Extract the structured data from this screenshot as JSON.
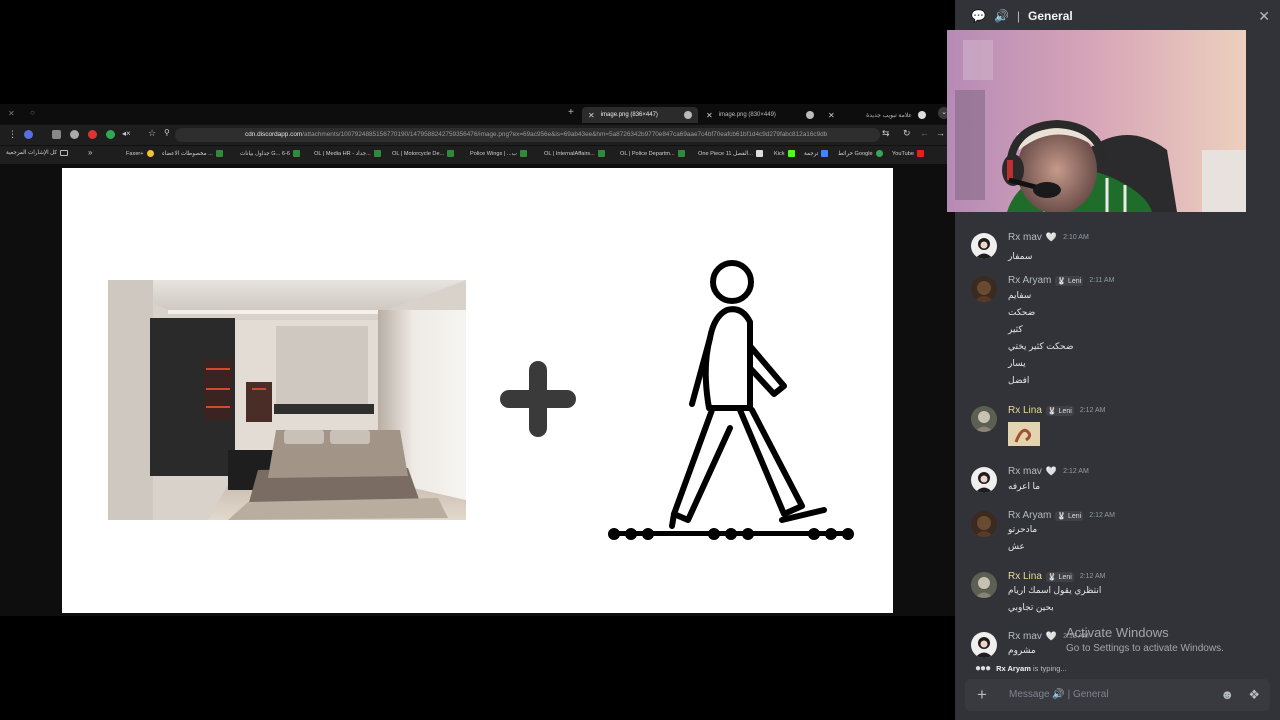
{
  "browser": {
    "tabs": [
      {
        "label": "علامة تبويب جديدة",
        "active": false
      },
      {
        "label": "image.png (830×449)",
        "active": false
      },
      {
        "label": "image.png (836×447)",
        "active": true
      }
    ],
    "url_host": "cdn.discordapp.com",
    "url_path": "/attachments/1007924885156770190/1479588242759356476/image.png?ex=69ac956e&is=69ab43ee&hm=5a8726342b9770e847ca69aae7c4bf70eafcb61bf1d4c9d279fabc812a16c9db",
    "bookmarks": [
      {
        "label": "YouTube",
        "color": "#e62117"
      },
      {
        "label": "خرائط Google",
        "color": "#34a853"
      },
      {
        "label": "ترجمة",
        "color": "#4285f4"
      },
      {
        "label": "Kick",
        "color": "#53fc18"
      },
      {
        "label": "One Piece الفصل 11...",
        "color": "#dddddd"
      },
      {
        "label": "OL | Police Departm...",
        "color": "#2e8b3a"
      },
      {
        "label": "OL | InternalAffairs...",
        "color": "#2e8b3a"
      },
      {
        "label": "Police Wings | ...ب",
        "color": "#2e8b3a"
      },
      {
        "label": "OL | Motorcycle De...",
        "color": "#2e8b3a"
      },
      {
        "label": "OL | Media HR - جداد...",
        "color": "#2e8b3a"
      },
      {
        "label": "جداول بيانات G... 6-6",
        "color": "#2e8b3a"
      },
      {
        "label": "مخصوطات الاعضاء ...",
        "color": "#2e8b3a"
      },
      {
        "label": "Faxer+",
        "color": "#f4c430"
      }
    ],
    "bookmarks_more": "»",
    "bookmarks_folder": "كل الإشارات المرجعية"
  },
  "slide": {
    "plus_symbol": "+"
  },
  "panel": {
    "channel_name": "General",
    "messages": [
      {
        "user": "Rx mav",
        "heart": true,
        "badge": "",
        "time": "2:10 AM",
        "lines": [
          "سمفار"
        ],
        "avatar": "mav"
      },
      {
        "user": "Rx Aryam",
        "heart": false,
        "badge": "Leni",
        "time": "2:11 AM",
        "lines": [
          "سفايم",
          "ضحكت",
          "كثير",
          "ضحكت كثير يختي",
          "يسار",
          "افضل"
        ],
        "avatar": "aryam"
      },
      {
        "user": "Rx Lina",
        "heart": false,
        "badge": "Leni",
        "time": "2:12 AM",
        "lines": [],
        "image": true,
        "avatar": "lina"
      },
      {
        "user": "Rx mav",
        "heart": true,
        "badge": "",
        "time": "2:12 AM",
        "lines": [
          "ما اعرفه"
        ],
        "avatar": "mav"
      },
      {
        "user": "Rx Aryam",
        "heart": false,
        "badge": "Leni",
        "time": "2:12 AM",
        "lines": [
          "مادحرتو",
          "عش"
        ],
        "avatar": "aryam"
      },
      {
        "user": "Rx Lina",
        "heart": false,
        "badge": "Leni",
        "time": "2:12 AM",
        "lines": [
          "انتظري يقول اسمك اريام",
          "بحين تجاوبي"
        ],
        "avatar": "lina"
      },
      {
        "user": "Rx mav",
        "heart": true,
        "badge": "",
        "time": "2:13 AM",
        "lines": [
          "مشروم"
        ],
        "avatar": "mav"
      }
    ],
    "typing_user": "Rx Aryam",
    "typing_suffix": "is typing...",
    "composer_placeholder": "Message 🔊 | General"
  },
  "watermark": {
    "title": "Activate Windows",
    "subtitle": "Go to Settings to activate Windows."
  }
}
